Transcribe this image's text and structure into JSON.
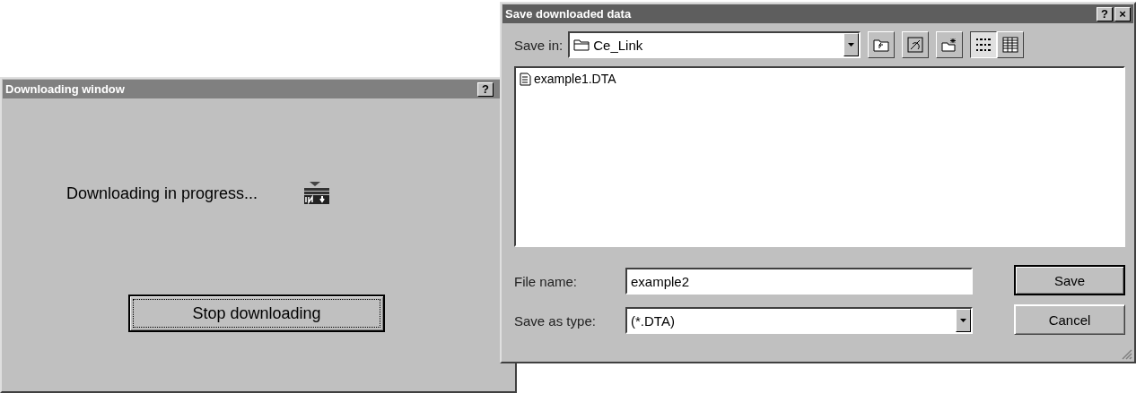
{
  "download_window": {
    "title": "Downloading window",
    "title_buttons": [
      "?"
    ],
    "message": "Downloading in progress...",
    "button": "Stop downloading"
  },
  "save_dialog": {
    "title": "Save downloaded data",
    "title_buttons": [
      "?",
      "×"
    ],
    "save_in": {
      "label": "Save in:",
      "value": "Ce_Link"
    },
    "view_buttons": [
      {
        "kind": "up",
        "selected": false
      },
      {
        "kind": "desktop",
        "selected": false
      },
      {
        "kind": "new-folder",
        "selected": false
      },
      {
        "kind": "list",
        "selected": true
      },
      {
        "kind": "details",
        "selected": false
      }
    ],
    "files": [
      {
        "name": "example1.DTA",
        "selected": false
      }
    ],
    "file_name": {
      "label": "File name:",
      "value": "example2"
    },
    "save_as_type": {
      "label": "Save as type:",
      "value": "(*.DTA)"
    },
    "buttons": [
      "Save",
      "Cancel"
    ]
  }
}
